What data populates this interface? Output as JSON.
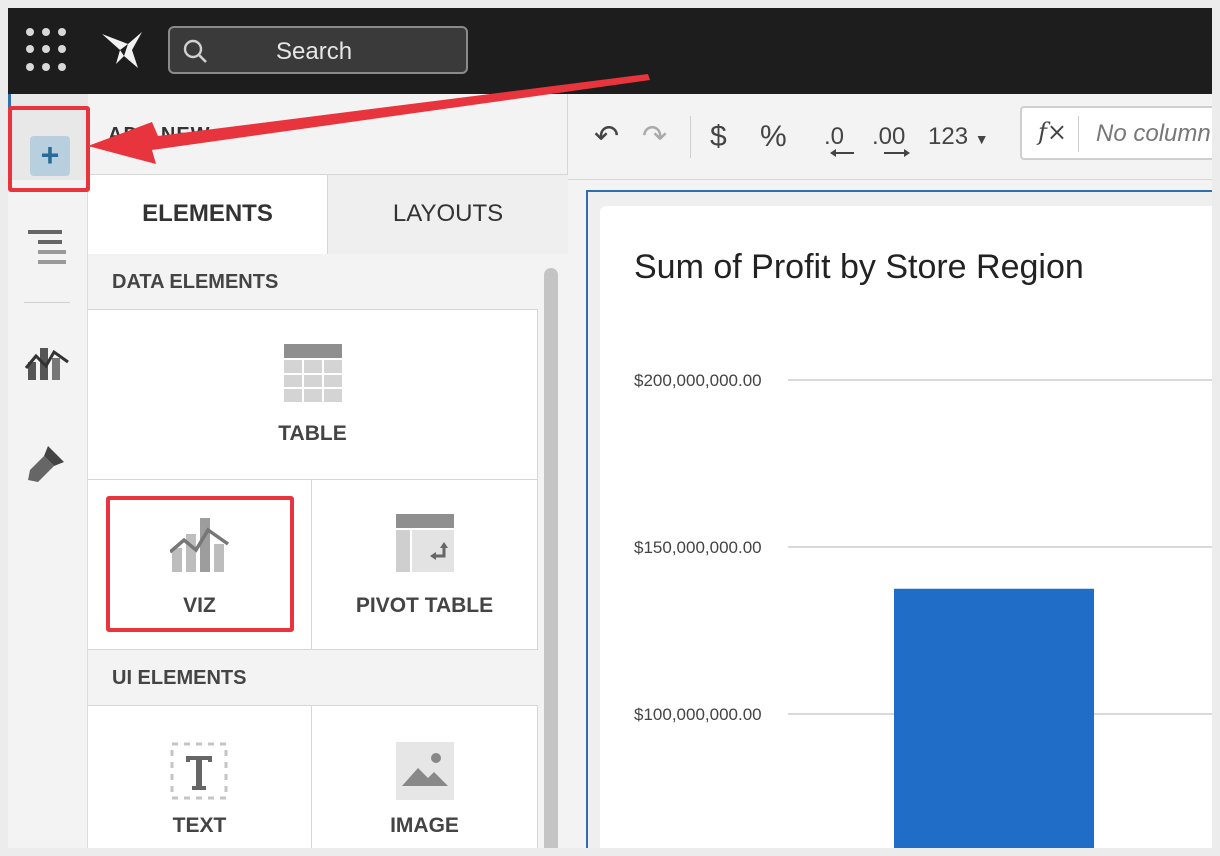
{
  "topbar": {
    "search_label": "Search",
    "icons": {
      "apps": "apps-grid-icon",
      "logo": "sigma-logo-icon",
      "search": "search-icon"
    }
  },
  "rail": {
    "icons": [
      "add-icon",
      "outline-icon",
      "data-icon",
      "format-brush-icon"
    ]
  },
  "panel": {
    "title": "ADD NEW",
    "tabs": [
      {
        "label": "ELEMENTS",
        "active": true
      },
      {
        "label": "LAYOUTS",
        "active": false
      }
    ],
    "data_elements_header": "DATA ELEMENTS",
    "data_elements": [
      {
        "label": "TABLE",
        "icon": "table-icon"
      },
      {
        "label": "VIZ",
        "icon": "viz-icon"
      },
      {
        "label": "PIVOT TABLE",
        "icon": "pivot-table-icon"
      }
    ],
    "ui_elements_header": "UI ELEMENTS",
    "ui_elements": [
      {
        "label": "TEXT",
        "icon": "text-icon"
      },
      {
        "label": "IMAGE",
        "icon": "image-icon"
      }
    ]
  },
  "toolbar": {
    "undo": "↶",
    "redo": "↷",
    "currency": "$",
    "percent": "%",
    "decrease_decimals": ".0",
    "increase_decimals": ".00",
    "number_format": "123",
    "formula_placeholder": "No column"
  },
  "chart_data": {
    "type": "bar",
    "title": "Sum of Profit by Store Region",
    "y_ticks": [
      "$200,000,000.00",
      "$150,000,000.00",
      "$100,000,000.00"
    ],
    "y_tick_values": [
      200000000,
      150000000,
      100000000
    ],
    "categories": [
      ""
    ],
    "values": [
      137500000
    ],
    "bar_color": "#1f6dc6",
    "grid": true
  },
  "annotations": {
    "highlight_color": "#e8343c"
  }
}
